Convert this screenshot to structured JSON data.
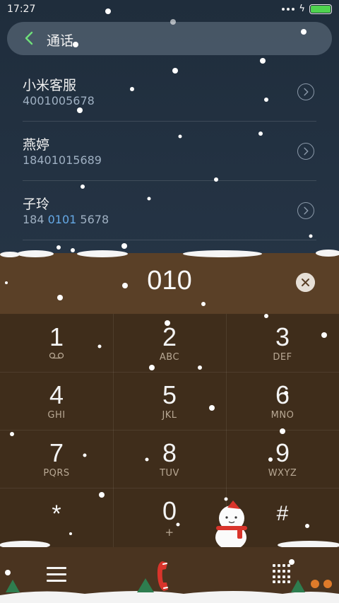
{
  "status_bar": {
    "time": "17:27",
    "battery_level": 1.0
  },
  "header": {
    "title": "通话"
  },
  "contacts": [
    {
      "name": "小米客服",
      "number_parts": [
        "400",
        "1005678"
      ],
      "highlight_index": -1,
      "number_display": "4001005678",
      "num_before": "400",
      "num_match": "",
      "num_after": "1005678"
    },
    {
      "name": "燕婷",
      "num_before": "18401015689",
      "num_match": "",
      "num_after": ""
    },
    {
      "name": "子玲",
      "num_before": "184 ",
      "num_match": "0101",
      "num_after": " 5678"
    }
  ],
  "dialer": {
    "input_value": "010",
    "keys": [
      {
        "digit": "1",
        "letters": ""
      },
      {
        "digit": "2",
        "letters": "ABC"
      },
      {
        "digit": "3",
        "letters": "DEF"
      },
      {
        "digit": "4",
        "letters": "GHI"
      },
      {
        "digit": "5",
        "letters": "JKL"
      },
      {
        "digit": "6",
        "letters": "MNO"
      },
      {
        "digit": "7",
        "letters": "PQRS"
      },
      {
        "digit": "8",
        "letters": "TUV"
      },
      {
        "digit": "9",
        "letters": "WXYZ"
      },
      {
        "digit": "*",
        "letters": ""
      },
      {
        "digit": "0",
        "letters": "+"
      },
      {
        "digit": "#",
        "letters": ""
      }
    ]
  },
  "colors": {
    "accent_green": "#4fd34f",
    "match_blue": "#65a9e6",
    "call_red": "#d9342b"
  },
  "icons": {
    "back": "chevron-left-icon",
    "contact_detail": "chevron-right-circle-icon",
    "clear": "close-circle-icon",
    "voicemail": "voicemail-icon",
    "menu": "menu-icon",
    "call": "phone-call-icon",
    "keypad_toggle": "keypad-grid-icon"
  }
}
